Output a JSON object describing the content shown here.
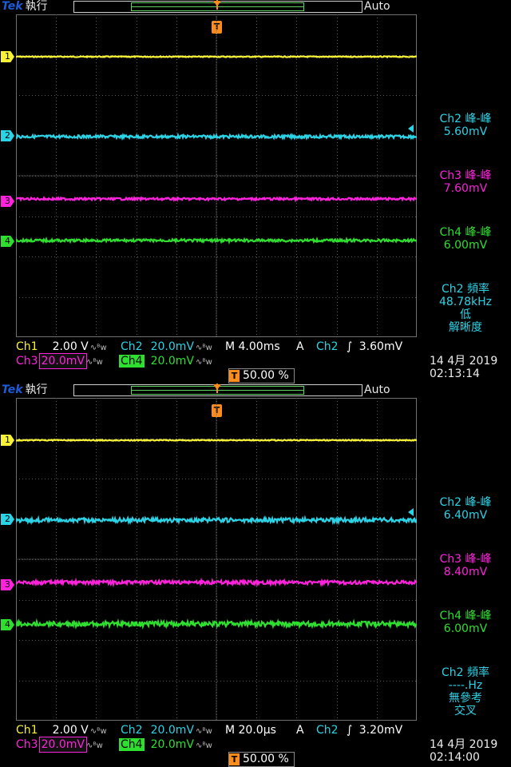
{
  "colors": {
    "ch1": "#f7f236",
    "ch2": "#2bd3e6",
    "ch3": "#ff22dd",
    "ch4": "#2fdf2f",
    "trigger": "#ff8c1a"
  },
  "screens": [
    {
      "brand": "Tek",
      "mode": "執行",
      "trigger_state": "Auto",
      "trigger_mark": "T",
      "channel_markers": [
        "1",
        "2",
        "3",
        "4"
      ],
      "measurements": [
        {
          "l1": "Ch2 峰-峰",
          "l2": "5.60mV"
        },
        {
          "l1": "Ch3 峰-峰",
          "l2": "7.60mV"
        },
        {
          "l1": "Ch4 峰-峰",
          "l2": "6.00mV"
        },
        {
          "l1": "Ch2 頻率",
          "l2": "48.78kHz",
          "l3": "低",
          "l4": "解晰度"
        }
      ],
      "ch1": {
        "label": "Ch1",
        "scale": "2.00 V"
      },
      "ch2": {
        "label": "Ch2",
        "scale": "20.0mV"
      },
      "ch3": {
        "label": "Ch3",
        "scale": "20.0mV"
      },
      "ch4": {
        "label": "Ch4",
        "scale": "20.0mV"
      },
      "bw_icon": "∿ᴮw",
      "timebase": "M 4.00ms",
      "acq": "A",
      "trig_source": "Ch2",
      "trig_slope": "∫",
      "trig_level": "3.60mV",
      "trig_position": "50.00 %",
      "date": "14 4月  2019",
      "time": "02:13:14"
    },
    {
      "brand": "Tek",
      "mode": "執行",
      "trigger_state": "Auto",
      "trigger_mark": "T",
      "channel_markers": [
        "1",
        "2",
        "3",
        "4"
      ],
      "measurements": [
        {
          "l1": "Ch2 峰-峰",
          "l2": "6.40mV"
        },
        {
          "l1": "Ch3 峰-峰",
          "l2": "8.40mV"
        },
        {
          "l1": "Ch4 峰-峰",
          "l2": "6.00mV"
        },
        {
          "l1": "Ch2 頻率",
          "l2": "----.Hz",
          "l3": "無參考",
          "l4": "交叉"
        }
      ],
      "ch1": {
        "label": "Ch1",
        "scale": "2.00 V"
      },
      "ch2": {
        "label": "Ch2",
        "scale": "20.0mV"
      },
      "ch3": {
        "label": "Ch3",
        "scale": "20.0mV"
      },
      "ch4": {
        "label": "Ch4",
        "scale": "20.0mV"
      },
      "bw_icon": "∿ᴮw",
      "timebase": "M 20.0µs",
      "acq": "A",
      "trig_source": "Ch2",
      "trig_slope": "∫",
      "trig_level": "3.20mV",
      "trig_position": "50.00 %",
      "date": "14 4月  2019",
      "time": "02:14:00"
    }
  ]
}
